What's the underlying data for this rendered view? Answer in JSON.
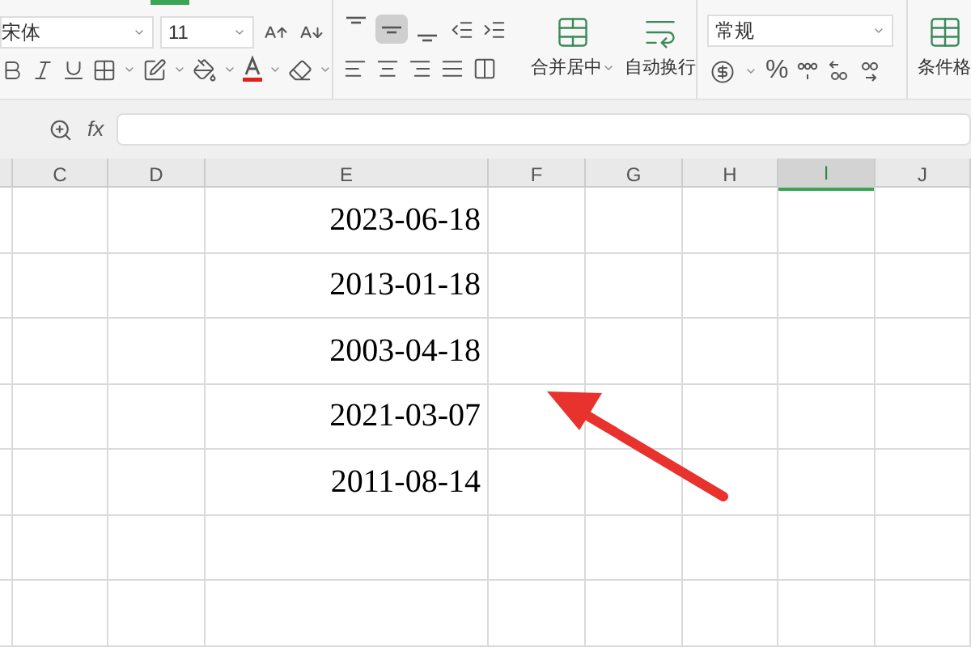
{
  "ribbon": {
    "font": {
      "name": "宋体",
      "size": "11"
    },
    "vertical_align": [
      {
        "kind": "top",
        "selected": false
      },
      {
        "kind": "middle",
        "selected": true
      },
      {
        "kind": "bottom",
        "selected": false
      }
    ],
    "merge_label": "合并居中",
    "wrap_label": "自动换行",
    "number_format": "常规",
    "percent": "%",
    "conditional_label": "条件格"
  },
  "formula_bar": {
    "fx": "fx"
  },
  "columns": [
    {
      "label": "C",
      "selected": false
    },
    {
      "label": "D",
      "selected": false
    },
    {
      "label": "E",
      "selected": false
    },
    {
      "label": "F",
      "selected": false
    },
    {
      "label": "G",
      "selected": false
    },
    {
      "label": "H",
      "selected": false
    },
    {
      "label": "I",
      "selected": true
    },
    {
      "label": "J",
      "selected": false
    }
  ],
  "cells_e": [
    "2023-06-18",
    "2013-01-18",
    "2003-04-18",
    "2021-03-07",
    "2011-08-14"
  ]
}
